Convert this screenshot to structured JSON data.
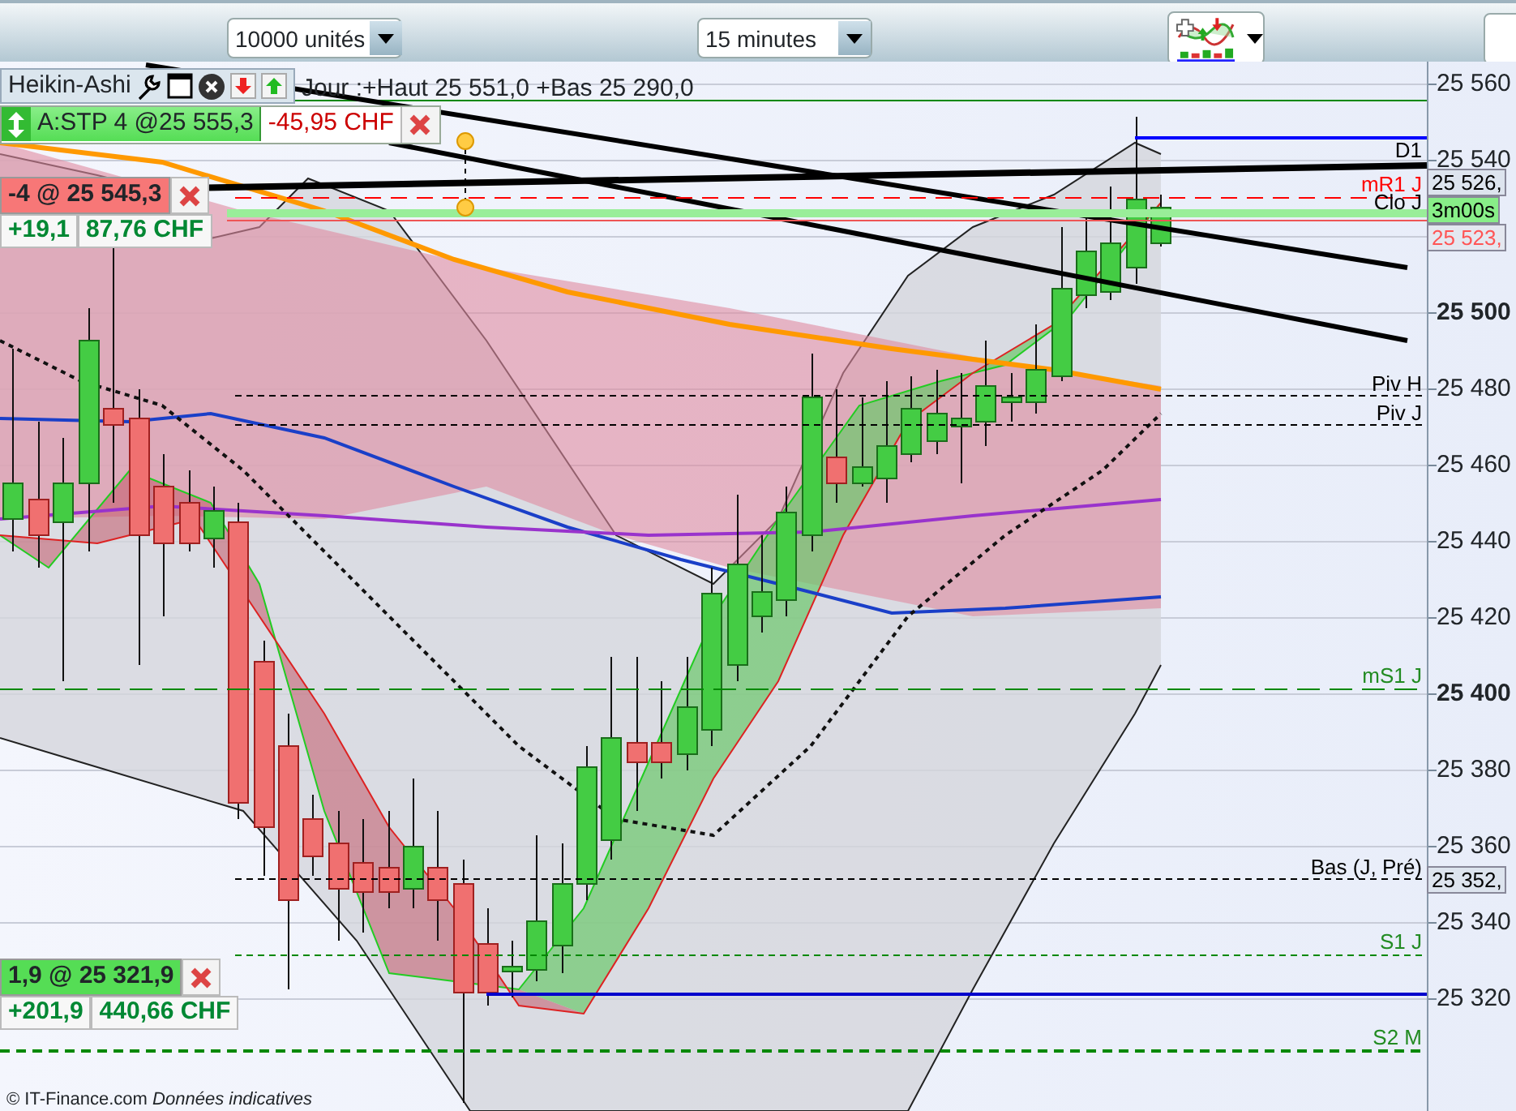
{
  "toolbar": {
    "quantity_select": "10000 unités",
    "interval_select": "15 minutes"
  },
  "chart": {
    "type_label": "Heikin-Ashi",
    "day_range": "Jour :+Haut 25 551,0 +Bas 25 290,0"
  },
  "orders": [
    {
      "kind": "stop",
      "label": "A:STP 4 @25 555,3",
      "pnl": "-45,95 CHF"
    }
  ],
  "positions": [
    {
      "color": "#f77777",
      "label": "-4 @ 25 545,3",
      "points": "+19,1",
      "pnl": "87,76 CHF"
    },
    {
      "color": "#55dd55",
      "label": "1,9 @ 25 321,9",
      "points": "+201,9",
      "pnl": "440,66 CHF"
    }
  ],
  "level_labels": [
    {
      "text": "D1",
      "color": "#000000"
    },
    {
      "text": "mR1 J",
      "color": "#ff0000"
    },
    {
      "text": "Clo J",
      "color": "#000000"
    },
    {
      "text": "Piv H",
      "color": "#000000"
    },
    {
      "text": "Piv J",
      "color": "#000000"
    },
    {
      "text": "mS1 J",
      "color": "#228b22"
    },
    {
      "text": "Bas (J, Pré)",
      "color": "#000000"
    },
    {
      "text": "S1 J",
      "color": "#228b22"
    },
    {
      "text": "S2 M",
      "color": "#228b22"
    }
  ],
  "price_axis": {
    "labels": [
      {
        "text": "25 560",
        "major": false
      },
      {
        "text": "25 540",
        "major": false
      },
      {
        "text": "25 500",
        "major": true
      },
      {
        "text": "25 480",
        "major": false
      },
      {
        "text": "25 460",
        "major": false
      },
      {
        "text": "25 440",
        "major": false
      },
      {
        "text": "25 420",
        "major": false
      },
      {
        "text": "25 400",
        "major": true
      },
      {
        "text": "25 380",
        "major": false
      },
      {
        "text": "25 360",
        "major": false
      },
      {
        "text": "25 340",
        "major": false
      },
      {
        "text": "25 320",
        "major": false
      }
    ]
  },
  "axis_tags": [
    {
      "kind": "price",
      "text": "25 526,"
    },
    {
      "kind": "timer",
      "text": "3m00s"
    },
    {
      "kind": "bid",
      "text": "25 523,"
    },
    {
      "kind": "price",
      "text": "25 352,"
    }
  ],
  "footer": {
    "copyright": "© IT-Finance.com",
    "disclaimer": "Données indicatives"
  }
}
